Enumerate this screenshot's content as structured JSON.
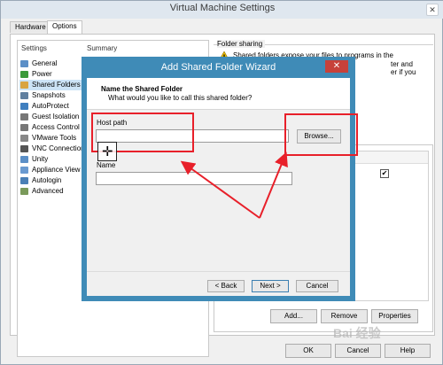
{
  "window": {
    "title": "Virtual Machine Settings",
    "close_glyph": "✕"
  },
  "tabs": [
    {
      "label": "Hardware"
    },
    {
      "label": "Options"
    }
  ],
  "settings_list": {
    "header_settings": "Settings",
    "header_summary": "Summary",
    "items": [
      {
        "label": "General",
        "icon": "general-icon",
        "color": "#5b8fc7"
      },
      {
        "label": "Power",
        "icon": "power-icon",
        "color": "#3a9a3a"
      },
      {
        "label": "Shared Folders",
        "icon": "shared-folders-icon",
        "color": "#d9a441"
      },
      {
        "label": "Snapshots",
        "icon": "snapshots-icon",
        "color": "#5f7f9f"
      },
      {
        "label": "AutoProtect",
        "icon": "autoprotect-icon",
        "color": "#3f7fbf"
      },
      {
        "label": "Guest Isolation",
        "icon": "guest-isolation-icon",
        "color": "#777777"
      },
      {
        "label": "Access Control",
        "icon": "access-control-icon",
        "color": "#777777"
      },
      {
        "label": "VMware Tools",
        "icon": "vmware-tools-icon",
        "color": "#888888"
      },
      {
        "label": "VNC Connections",
        "icon": "vnc-icon",
        "color": "#555555"
      },
      {
        "label": "Unity",
        "icon": "unity-icon",
        "color": "#5b8fc7"
      },
      {
        "label": "Appliance View",
        "icon": "appliance-view-icon",
        "color": "#6a9ad0"
      },
      {
        "label": "Autologin",
        "icon": "autologin-icon",
        "color": "#4a7fb5"
      },
      {
        "label": "Advanced",
        "icon": "advanced-icon",
        "color": "#7a9a5a"
      }
    ]
  },
  "folder_sharing": {
    "title": "Folder sharing",
    "text_1": "Shared folders expose your files to programs in the",
    "text_2": "ter and",
    "text_3": "er if you"
  },
  "folder_buttons": {
    "add": "Add...",
    "remove": "Remove",
    "properties": "Properties"
  },
  "dialog_buttons": {
    "ok": "OK",
    "cancel": "Cancel",
    "help": "Help"
  },
  "wizard": {
    "title": "Add Shared Folder Wizard",
    "close_glyph": "✕",
    "heading": "Name the Shared Folder",
    "subheading": "What would you like to call this shared folder?",
    "host_label": "Host path",
    "host_value": "",
    "browse_label": "Browse...",
    "name_label": "Name",
    "name_value": "",
    "back_label": "< Back",
    "next_label": "Next >",
    "cancel_label": "Cancel"
  },
  "annotation": {
    "color": "#e8202a",
    "cursor_glyph": "✛"
  },
  "watermark": "Bai 经验"
}
